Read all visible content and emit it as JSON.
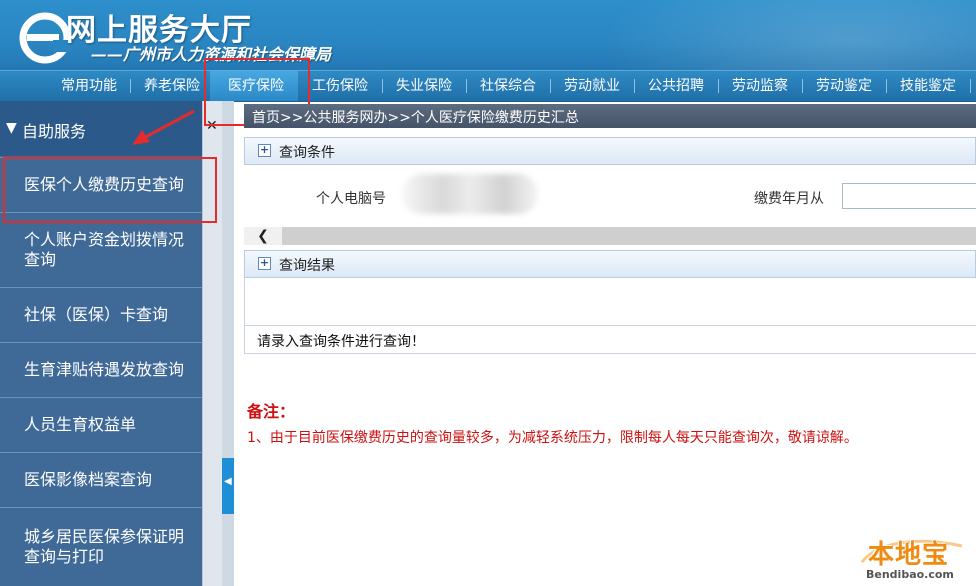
{
  "header": {
    "title": "网上服务大厅",
    "subtitle": "——广州市人力资源和社会保障局"
  },
  "nav": {
    "active_index": 2,
    "items": [
      "常用功能",
      "养老保险",
      "医疗保险",
      "工伤保险",
      "失业保险",
      "社保综合",
      "劳动就业",
      "公共招聘",
      "劳动监察",
      "劳动鉴定",
      "技能鉴定"
    ]
  },
  "sidebar": {
    "section_title": "自助服务",
    "collapse_icon": "close-icon",
    "items": [
      "医保个人缴费历史查询",
      "个人账户资金划拨情况查询",
      "社保（医保）卡查询",
      "生育津贴待遇发放查询",
      "人员生育权益单",
      "医保影像档案查询",
      "城乡居民医保参保证明查询与打印"
    ]
  },
  "breadcrumb": "首页>>公共服务网办>>个人医疗保险缴费历史汇总",
  "query_section": {
    "title": "查询条件",
    "id_label": "个人电脑号",
    "id_value": "",
    "month_from_label": "缴费年月从",
    "month_from_value": ""
  },
  "result_section": {
    "title": "查询结果",
    "message": "请录入查询条件进行查询！"
  },
  "notes": {
    "title": "备注：",
    "text": "1、由于目前医保缴费历史的查询量较多，为减轻系统压力，限制每人每天只能查询次，敬请谅解。"
  },
  "watermark": {
    "brand": "本地宝",
    "domain": "Bendibao.com"
  },
  "colors": {
    "header_blue": "#2a86c2",
    "sidebar_blue": "#3f6a97",
    "highlight_red": "#e52b2b",
    "note_red": "#cc1111"
  }
}
